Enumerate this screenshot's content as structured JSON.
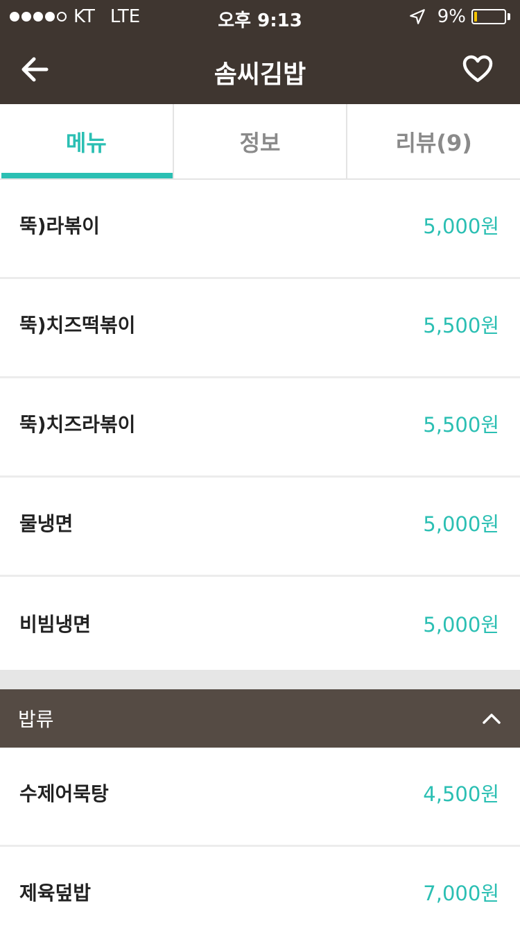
{
  "status_bar": {
    "carrier": "KT",
    "network": "LTE",
    "time": "오후 9:13",
    "battery_percent": "9%",
    "battery_level": 0.09
  },
  "nav": {
    "title": "솜씨김밥"
  },
  "tabs": [
    {
      "label": "메뉴",
      "active": true
    },
    {
      "label": "정보",
      "active": false
    },
    {
      "label": "리뷰(9)",
      "active": false
    }
  ],
  "menu_items": [
    {
      "name": "뚝)라볶이",
      "price": "5,000원"
    },
    {
      "name": "뚝)치즈떡볶이",
      "price": "5,500원"
    },
    {
      "name": "뚝)치즈라볶이",
      "price": "5,500원"
    },
    {
      "name": "물냉면",
      "price": "5,000원"
    },
    {
      "name": "비빔냉면",
      "price": "5,000원"
    }
  ],
  "section": {
    "title": "밥류",
    "items": [
      {
        "name": "수제어묵탕",
        "price": "4,500원"
      },
      {
        "name": "제육덮밥",
        "price": "7,000원"
      }
    ]
  },
  "colors": {
    "accent": "#2bbfb3",
    "header_bg": "#3f3630",
    "section_bg": "#554b44"
  }
}
